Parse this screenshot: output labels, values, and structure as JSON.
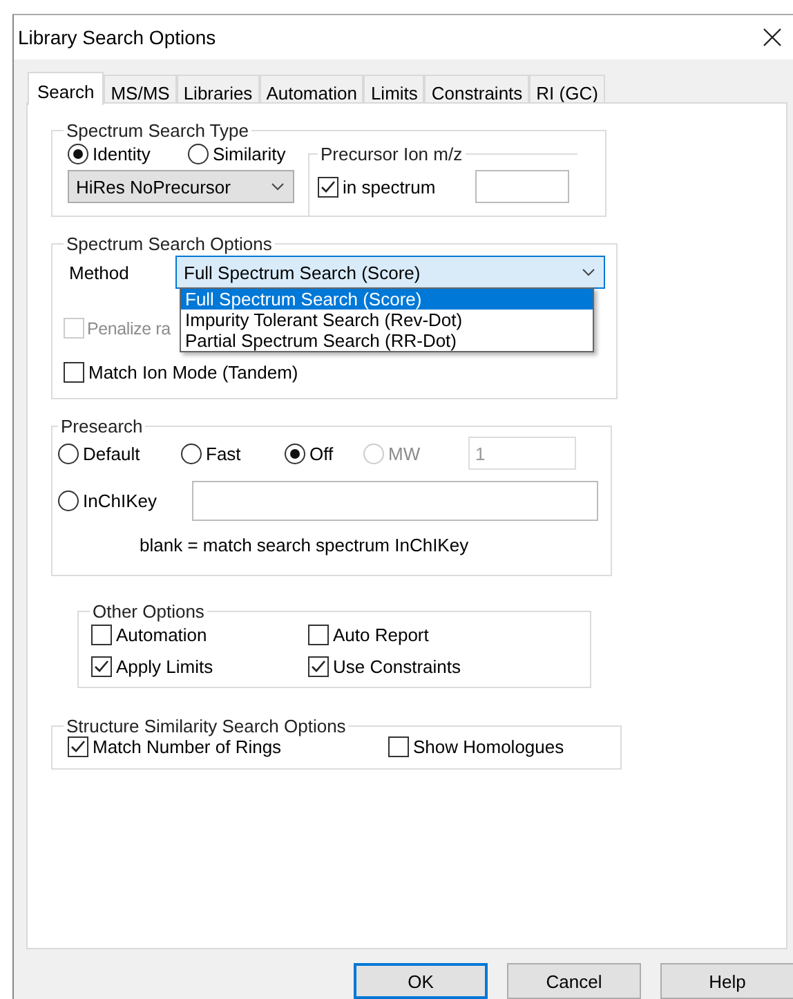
{
  "window": {
    "title": "Library Search Options"
  },
  "tabs": [
    {
      "label": "Search",
      "selected": true
    },
    {
      "label": "MS/MS",
      "selected": false
    },
    {
      "label": "Libraries",
      "selected": false
    },
    {
      "label": "Automation",
      "selected": false
    },
    {
      "label": "Limits",
      "selected": false
    },
    {
      "label": "Constraints",
      "selected": false
    },
    {
      "label": "RI (GC)",
      "selected": false
    }
  ],
  "spectrum_search_type": {
    "title": "Spectrum Search Type",
    "options": [
      {
        "label": "Identity",
        "selected": true
      },
      {
        "label": "Similarity",
        "selected": false
      }
    ],
    "mode_dropdown": {
      "value": "HiRes NoPrecursor"
    },
    "precursor": {
      "title": "Precursor Ion m/z",
      "checkbox": {
        "label": "in spectrum",
        "checked": true
      }
    }
  },
  "spectrum_search_options": {
    "title": "Spectrum Search Options",
    "method": {
      "label": "Method",
      "value": "Full Spectrum Search (Score)",
      "expanded": true,
      "items": [
        {
          "label": "Full Spectrum Search (Score)",
          "selected": true
        },
        {
          "label": "Impurity Tolerant Search (Rev-Dot)",
          "selected": false
        },
        {
          "label": "Partial Spectrum Search (RR-Dot)",
          "selected": false
        }
      ]
    },
    "checkboxes": [
      {
        "label": "Penalize ra",
        "checked": false,
        "disabled": true
      },
      {
        "label": "Match Ion Mode (Tandem)",
        "checked": false,
        "disabled": false
      }
    ]
  },
  "presearch": {
    "title": "Presearch",
    "options": [
      {
        "label": "Default",
        "selected": false,
        "disabled": false
      },
      {
        "label": "Fast",
        "selected": false,
        "disabled": false
      },
      {
        "label": "Off",
        "selected": true,
        "disabled": false
      },
      {
        "label": "MW",
        "selected": false,
        "disabled": true
      }
    ],
    "mw_value": "1",
    "inchikey": {
      "label": "InChIKey",
      "selected": false
    },
    "hint": "blank = match search spectrum InChIKey"
  },
  "other_options": {
    "title": "Other Options",
    "checkboxes": [
      {
        "label": "Automation",
        "checked": false
      },
      {
        "label": "Auto Report",
        "checked": false
      },
      {
        "label": "Apply Limits",
        "checked": true
      },
      {
        "label": "Use Constraints",
        "checked": true
      }
    ]
  },
  "structure_similarity": {
    "title": "Structure Similarity Search Options",
    "checkboxes": [
      {
        "label": "Match Number of Rings",
        "checked": true
      },
      {
        "label": "Show Homologues",
        "checked": false
      }
    ]
  },
  "buttons": [
    {
      "label": "OK",
      "default": true
    },
    {
      "label": "Cancel",
      "default": false
    },
    {
      "label": "Help",
      "default": false
    }
  ]
}
